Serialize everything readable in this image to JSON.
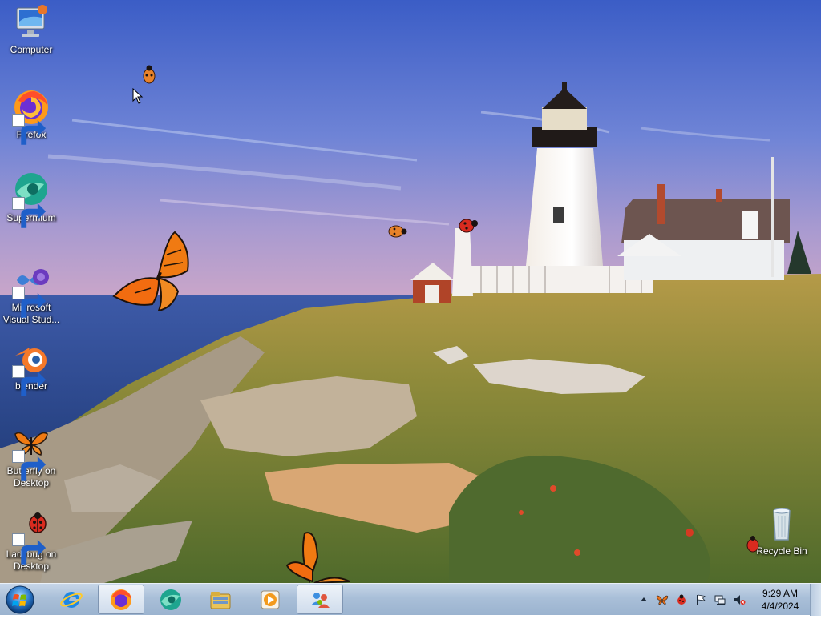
{
  "desktop": {
    "icons": [
      {
        "label": "Computer",
        "icon": "computer-icon"
      },
      {
        "label": "Firefox",
        "icon": "firefox-icon"
      },
      {
        "label": "Supermium",
        "icon": "supermium-icon"
      },
      {
        "label": "Microsoft Visual Stud...",
        "icon": "visual-studio-icon"
      },
      {
        "label": "blender",
        "icon": "blender-icon"
      },
      {
        "label": "Butterfly on Desktop",
        "icon": "butterfly-icon"
      },
      {
        "label": "Ladybug on Desktop",
        "icon": "ladybug-icon"
      },
      {
        "label": "Recycle Bin",
        "icon": "recycle-bin-icon"
      }
    ],
    "wallpaper": "lighthouse-coast-sunset"
  },
  "taskbar": {
    "start": "windows-start-icon",
    "pinned": [
      {
        "icon": "internet-explorer-icon",
        "active": false
      },
      {
        "icon": "firefox-icon",
        "active": true
      },
      {
        "icon": "supermium-icon",
        "active": false
      },
      {
        "icon": "file-explorer-icon",
        "active": false
      },
      {
        "icon": "media-player-icon",
        "active": false
      },
      {
        "icon": "people-app-icon",
        "active": true
      }
    ],
    "tray": {
      "icons": [
        "show-hidden-icons-arrow",
        "butterfly-icon",
        "ladybug-icon",
        "action-center-flag-icon",
        "network-icon",
        "volume-muted-icon"
      ],
      "time": "9:29 AM",
      "date": "4/4/2024"
    }
  },
  "colors": {
    "sky_top": "#3e5fc4",
    "sky_bottom": "#b9a7d6",
    "sea": "#2f4f9e",
    "grass": "#8e8a3c",
    "taskbar": "#b2c6dd",
    "butterfly": "#f07a12"
  }
}
